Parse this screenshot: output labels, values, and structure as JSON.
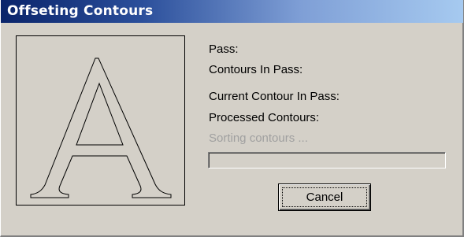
{
  "window": {
    "title": "Offseting Contours"
  },
  "preview": {
    "glyph": "A",
    "description_icon": "letter-outline-icon"
  },
  "info": {
    "pass_label": "Pass:",
    "contours_in_pass_label": "Contours In Pass:",
    "current_contour_label": "Current Contour In Pass:",
    "processed_contours_label": "Processed Contours:",
    "status_text": "Sorting contours ..."
  },
  "progress": {
    "value": 0
  },
  "buttons": {
    "cancel_label": "Cancel"
  }
}
